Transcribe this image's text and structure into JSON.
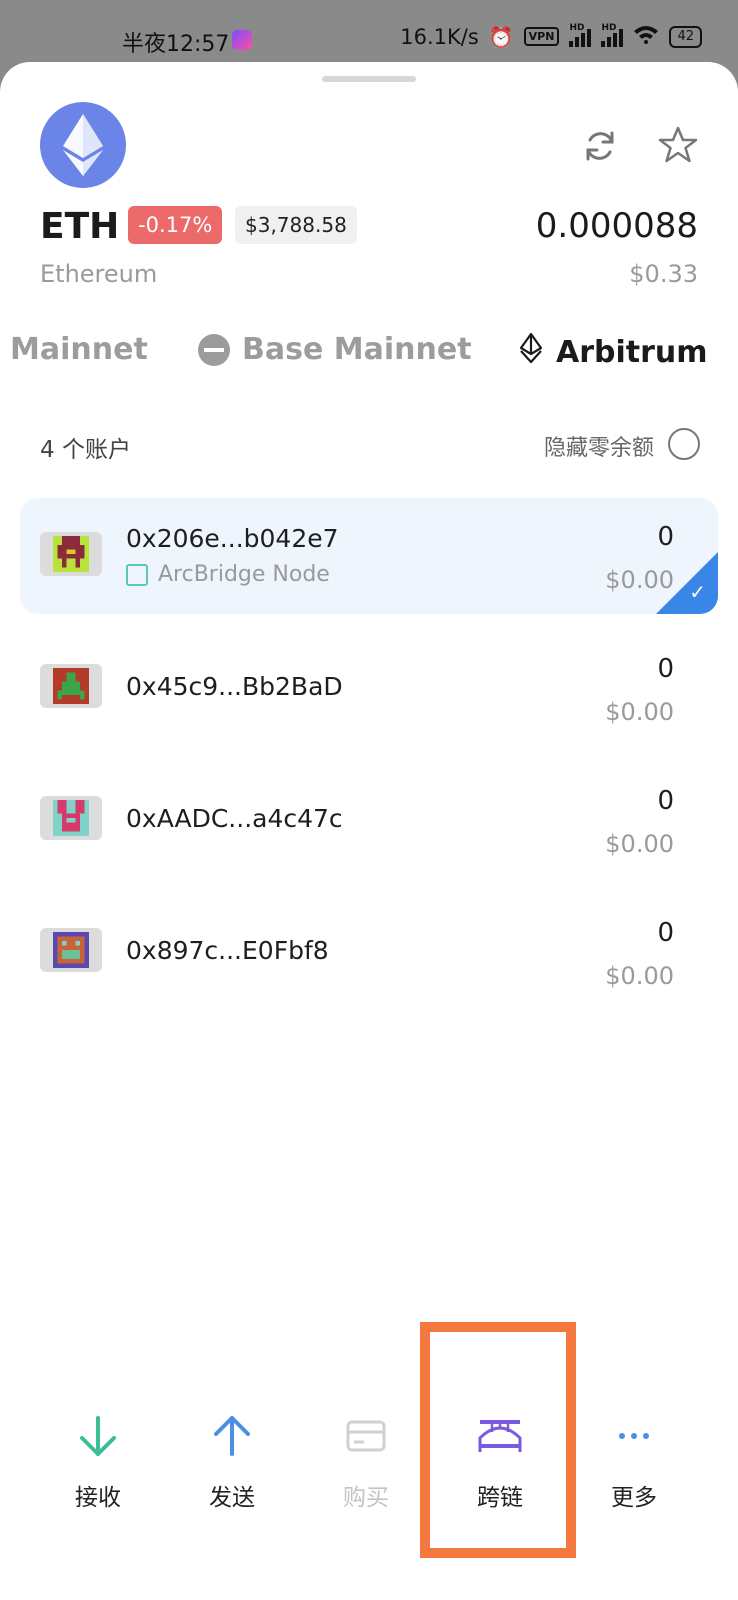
{
  "status_bar": {
    "time": "半夜12:57",
    "net_speed": "16.1K/s",
    "vpn": "VPN",
    "hd1": "HD",
    "hd2": "HD",
    "battery": "42"
  },
  "token": {
    "symbol": "ETH",
    "name": "Ethereum",
    "change": "-0.17%",
    "price": "$3,788.58",
    "balance": "0.000088",
    "balance_usd": "$0.33",
    "logo_icon": "ethereum-icon",
    "colors": {
      "logo_bg": "#6a84e8",
      "change_bg": "#ec6a6a"
    }
  },
  "networks": [
    {
      "label": "Mainnet",
      "active": false
    },
    {
      "label": "Base Mainnet",
      "active": false
    },
    {
      "label": "Arbitrum",
      "active": true
    }
  ],
  "accounts_header": {
    "count": "4 个账户",
    "hide_zero": "隐藏零余额"
  },
  "accounts": [
    {
      "address": "0x206e...b042e7",
      "node": "ArcBridge Node",
      "amount": "0",
      "usd": "$0.00",
      "selected": true
    },
    {
      "address": "0x45c9...Bb2BaD",
      "amount": "0",
      "usd": "$0.00",
      "selected": false
    },
    {
      "address": "0xAADC...a4c47c",
      "amount": "0",
      "usd": "$0.00",
      "selected": false
    },
    {
      "address": "0x897c...E0Fbf8",
      "amount": "0",
      "usd": "$0.00",
      "selected": false
    }
  ],
  "actions": [
    {
      "label": "接收",
      "icon": "arrow-down-icon",
      "color": "#3cbf98"
    },
    {
      "label": "发送",
      "icon": "arrow-up-icon",
      "color": "#4a90e2"
    },
    {
      "label": "购买",
      "icon": "card-icon",
      "color": "#d0d0d0",
      "disabled": true
    },
    {
      "label": "跨链",
      "icon": "bridge-icon",
      "color": "#7a5ae0"
    },
    {
      "label": "更多",
      "icon": "more-icon",
      "color": "#4a90e2"
    }
  ]
}
